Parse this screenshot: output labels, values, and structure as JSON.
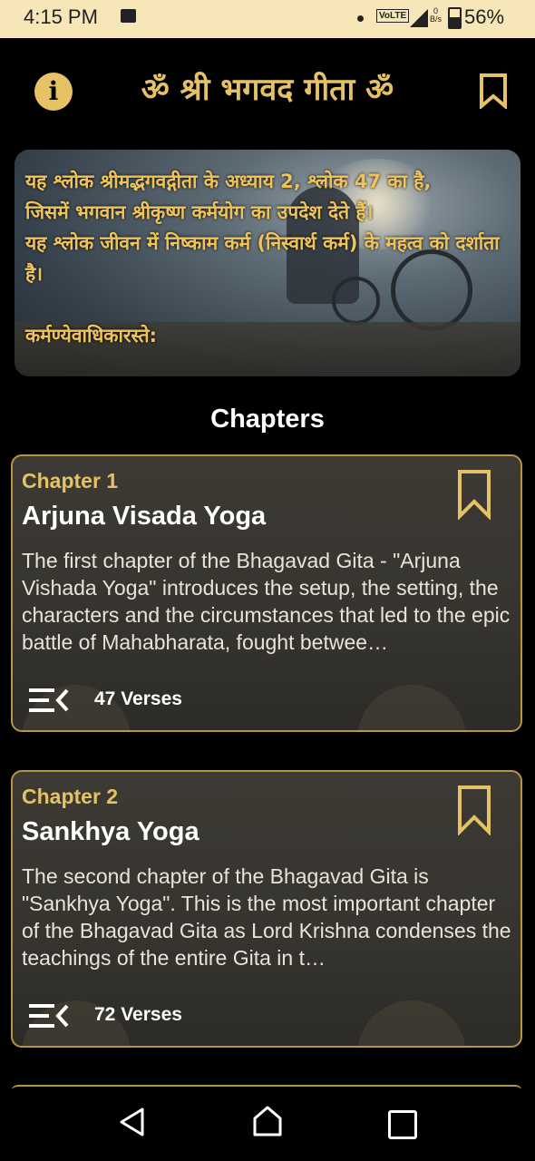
{
  "status_bar": {
    "time": "4:15 PM",
    "network_label": "VoLTE",
    "network_gen": "4G",
    "data_rate": "0\nB/s",
    "battery": "56%"
  },
  "app_bar": {
    "title": "ॐ श्री भगवद गीता ॐ",
    "info_icon": "info-icon",
    "bookmark_icon": "bookmark-icon"
  },
  "banner": {
    "text": "यह श्लोक श्रीमद्भगवद्गीता के अध्याय 2, श्लोक 47 का है,\nजिसमें भगवान श्रीकृष्ण कर्मयोग का उपदेश देते हैं।\nयह श्लोक जीवन में निष्काम कर्म (निस्वार्थ कर्म) के महत्व को दर्शाता है।\n\nकर्मण्येवाधिकारस्ते:"
  },
  "section_title": "Chapters",
  "chapters": [
    {
      "number_label": "Chapter 1",
      "name": "Arjuna Visada Yoga",
      "description": "The first chapter of the Bhagavad Gita - \"Arjuna Vishada Yoga\" introduces the setup, the setting, the characters and the circumstances that led to the epic battle of Mahabharata, fought betwee…",
      "verses": "47 Verses"
    },
    {
      "number_label": "Chapter 2",
      "name": "Sankhya Yoga",
      "description": "The second chapter of the Bhagavad Gita is \"Sankhya Yoga\". This is the most important chapter of the Bhagavad Gita as Lord Krishna condenses the teachings of the entire Gita in t…",
      "verses": "72 Verses"
    }
  ],
  "colors": {
    "accent_gold": "#e6c266",
    "card_border": "#b8963f",
    "status_bar_bg": "#f6e6b8"
  }
}
